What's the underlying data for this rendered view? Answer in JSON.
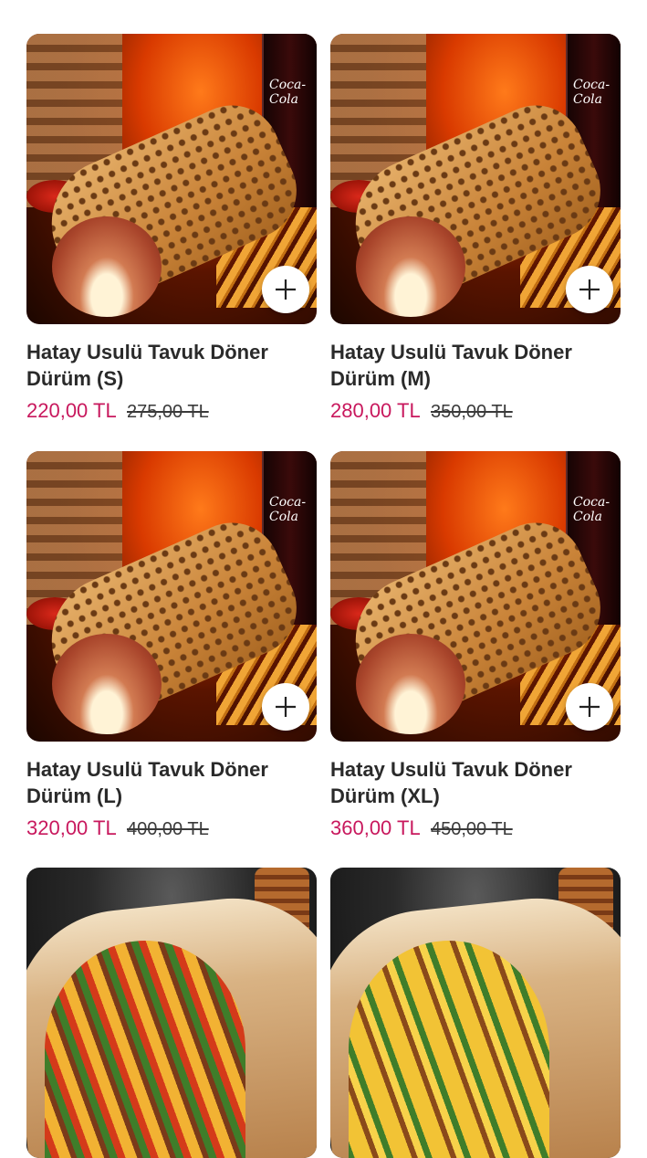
{
  "products": [
    {
      "name": "Hatay Usulü Tavuk Döner Dürüm (S)",
      "price": "220,00 TL",
      "old_price": "275,00 TL",
      "brand_on_cup": "Coca-Cola",
      "icon": "plus-icon"
    },
    {
      "name": "Hatay Usulü Tavuk Döner Dürüm (M)",
      "price": "280,00 TL",
      "old_price": "350,00 TL",
      "brand_on_cup": "Coca-Cola",
      "icon": "plus-icon"
    },
    {
      "name": "Hatay Usulü Tavuk Döner Dürüm (L)",
      "price": "320,00 TL",
      "old_price": "400,00 TL",
      "brand_on_cup": "Coca-Cola",
      "icon": "plus-icon"
    },
    {
      "name": "Hatay Usulü Tavuk Döner Dürüm (XL)",
      "price": "360,00 TL",
      "old_price": "450,00 TL",
      "brand_on_cup": "Coca-Cola",
      "icon": "plus-icon"
    }
  ],
  "colors": {
    "price": "#c8185d",
    "title": "#2a2a2a",
    "old_price": "#3a3a3a",
    "background": "#ffffff"
  }
}
